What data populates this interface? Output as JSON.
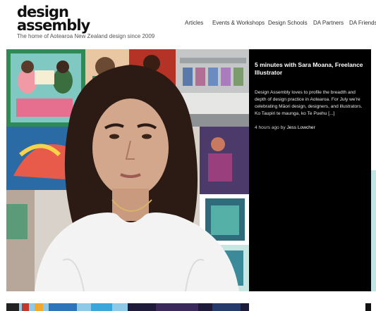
{
  "site": {
    "logo_line1": "design",
    "logo_line2": "assembly",
    "tagline": "The home of Aotearoa New Zealand design since 2009"
  },
  "nav": {
    "items": [
      {
        "label": "Articles"
      },
      {
        "label": "Events & Workshops"
      },
      {
        "label": "Design Schools"
      },
      {
        "label": "DA Partners"
      },
      {
        "label": "DA Friends"
      }
    ]
  },
  "feature": {
    "title": "5 minutes with Sara Moana, Freelance Illustrator",
    "excerpt": "Design Assembly loves to profile the breadth and depth of design practice in Aotearoa. For July we're celebrating Māori design, designers, and illustrators.  Ko Taupiri te maunga, ko Te Puehu [...]",
    "time": "4 hours ago by",
    "author": "Jess Lowcher"
  },
  "colors": {
    "panel_bg": "#000000",
    "accent_strip": "#bfe6e4"
  }
}
